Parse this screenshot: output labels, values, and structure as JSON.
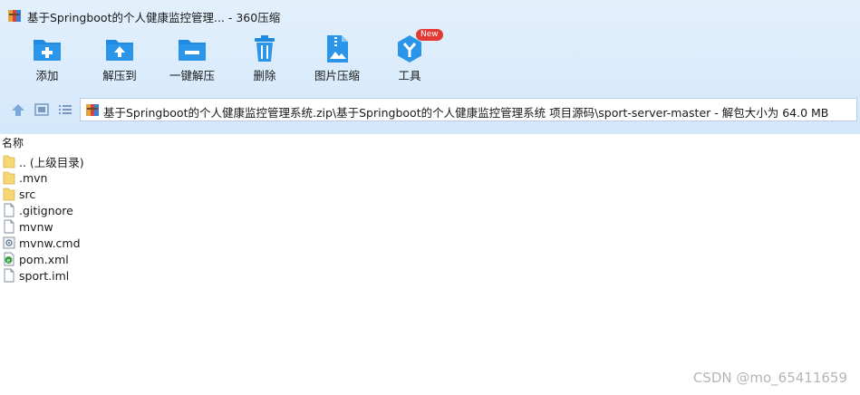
{
  "window": {
    "title": "基于Springboot的个人健康监控管理... - 360压缩"
  },
  "toolbar": {
    "buttons": [
      {
        "label": "添加",
        "icon": "add-folder-icon"
      },
      {
        "label": "解压到",
        "icon": "extract-to-icon"
      },
      {
        "label": "一键解压",
        "icon": "one-click-extract-icon"
      },
      {
        "label": "删除",
        "icon": "trash-icon"
      },
      {
        "label": "图片压缩",
        "icon": "image-compress-icon"
      },
      {
        "label": "工具",
        "icon": "tools-icon",
        "badge": "New"
      }
    ]
  },
  "address": {
    "path": "基于Springboot的个人健康监控管理系统.zip\\基于Springboot的个人健康监控管理系统 项目源码\\sport-server-master - 解包大小为 64.0 MB"
  },
  "list": {
    "column_name": "名称",
    "items": [
      {
        "name": ".. (上级目录)",
        "type": "folder"
      },
      {
        "name": ".mvn",
        "type": "folder"
      },
      {
        "name": "src",
        "type": "folder"
      },
      {
        "name": ".gitignore",
        "type": "file"
      },
      {
        "name": "mvnw",
        "type": "file"
      },
      {
        "name": "mvnw.cmd",
        "type": "cmd"
      },
      {
        "name": "pom.xml",
        "type": "xml"
      },
      {
        "name": "sport.iml",
        "type": "file"
      }
    ]
  },
  "watermark": "CSDN @mo_65411659",
  "colors": {
    "toolbar_bg": "#d4e8fb",
    "icon_blue": "#1f8ae0",
    "folder_yellow": "#f7d774",
    "badge_red": "#e53935"
  }
}
